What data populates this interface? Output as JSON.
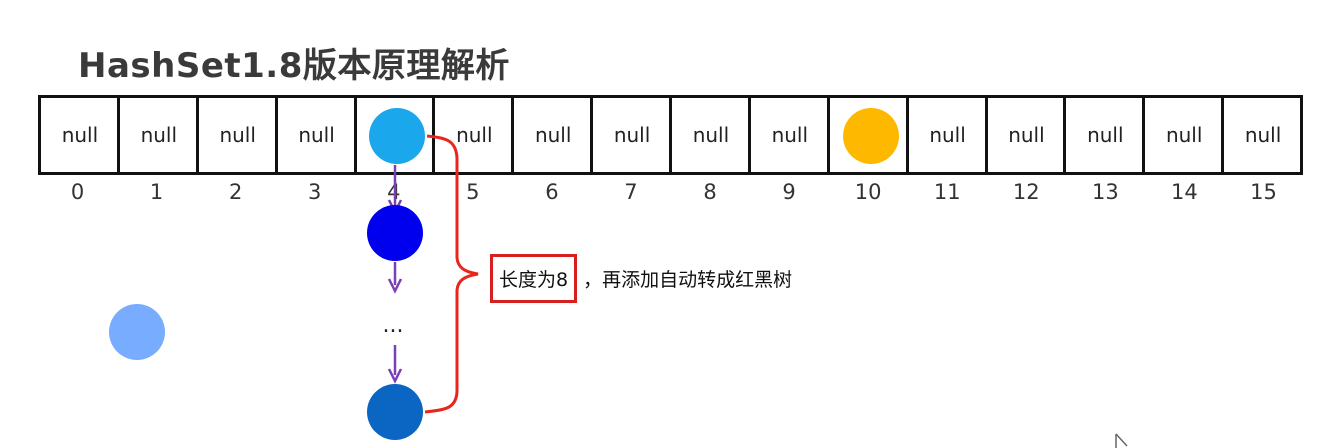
{
  "title": "HashSet1.8版本原理解析",
  "array": {
    "cells": [
      {
        "label": "null"
      },
      {
        "label": "null"
      },
      {
        "label": "null"
      },
      {
        "label": "null"
      },
      {
        "label": "",
        "node_color": "#1aa7ec"
      },
      {
        "label": "null"
      },
      {
        "label": "null"
      },
      {
        "label": "null"
      },
      {
        "label": "null"
      },
      {
        "label": "null"
      },
      {
        "label": "",
        "node_color": "#ffb800"
      },
      {
        "label": "null"
      },
      {
        "label": "null"
      },
      {
        "label": "null"
      },
      {
        "label": "null"
      },
      {
        "label": "null"
      }
    ],
    "indices": [
      "0",
      "1",
      "2",
      "3",
      "4",
      "5",
      "6",
      "7",
      "8",
      "9",
      "10",
      "11",
      "12",
      "13",
      "14",
      "15"
    ]
  },
  "chain": {
    "nodes": [
      {
        "color": "#0000ee"
      },
      {
        "color": "#0a66c2"
      }
    ],
    "ellipsis": "...",
    "arrow_color": "#7b3fb5"
  },
  "pending_node": {
    "color": "#78acff"
  },
  "bracket_color": "#e8261c",
  "callout": {
    "boxed_text": "长度为8",
    "rest_text": "，再添加自动转成红黑树",
    "box_color": "#d61f1f"
  }
}
